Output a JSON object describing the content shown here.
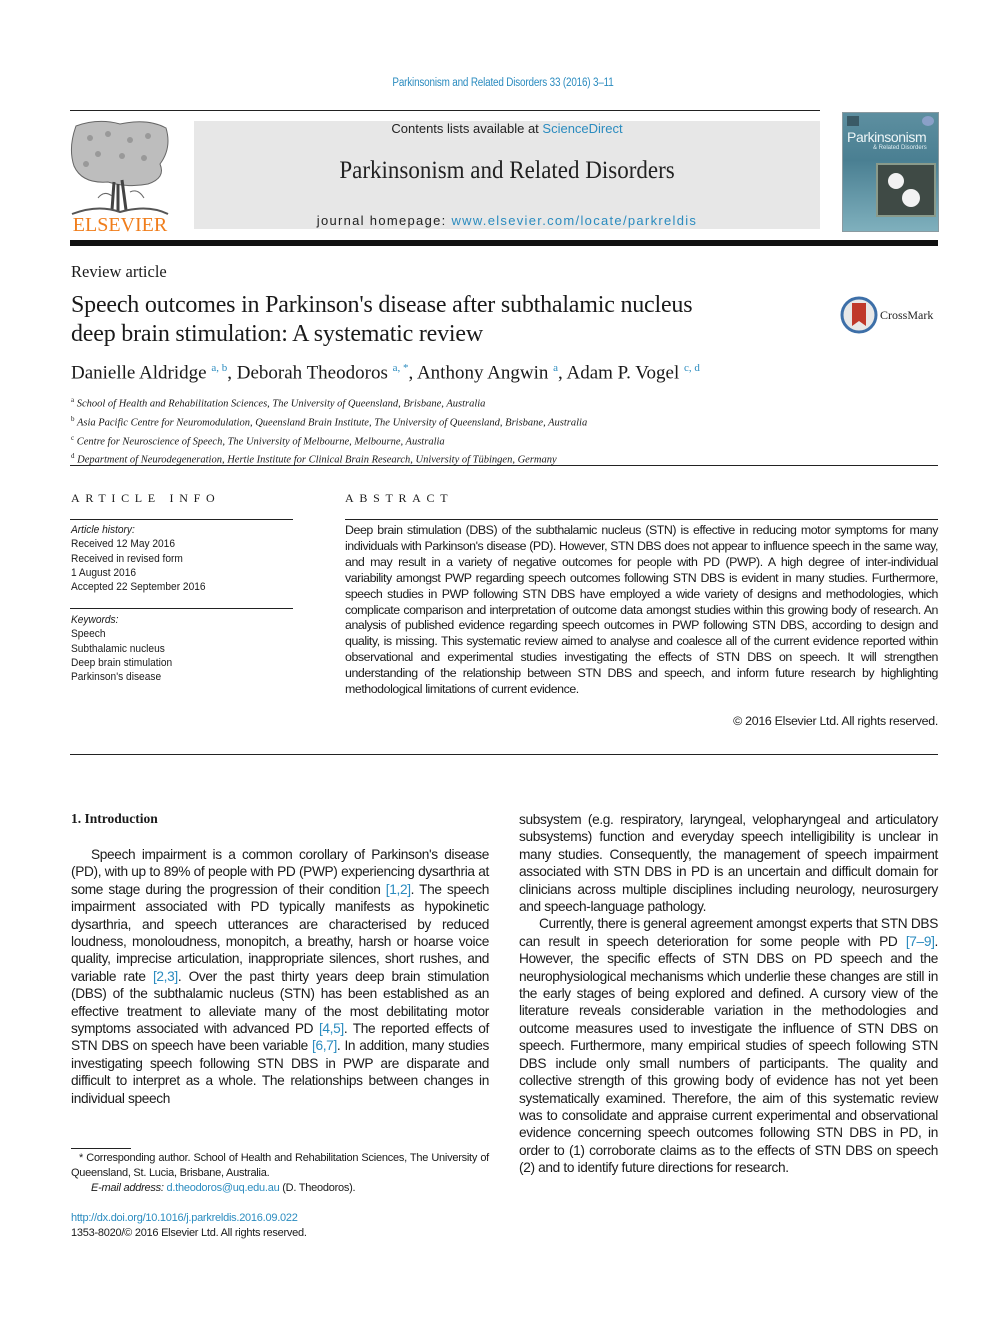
{
  "header": {
    "journal_ref": "Parkinsonism and Related Disorders 33 (2016) 3–11",
    "contents_prefix": "Contents lists available at ",
    "contents_link": "ScienceDirect",
    "journal_title": "Parkinsonism and Related Disorders",
    "homepage_prefix": "journal homepage: ",
    "homepage_link": "www.elsevier.com/locate/parkreldis",
    "publisher_logo": "ELSEVIER",
    "cover_title": "Parkinsonism",
    "cover_subtitle": "& Related Disorders",
    "colors": {
      "link": "#2a8bbf",
      "elsevier_orange": "#f07d1b",
      "banner_bg": "#e7e7e7"
    }
  },
  "article": {
    "type": "Review article",
    "title_line1": "Speech outcomes in Parkinson's disease after subthalamic nucleus",
    "title_line2": "deep brain stimulation: A systematic review",
    "crossmark_label": "CrossMark",
    "authors": [
      {
        "name": "Danielle Aldridge",
        "sup": "a, b",
        "sep": ", "
      },
      {
        "name": "Deborah Theodoros",
        "sup": "a, *",
        "sep": ", "
      },
      {
        "name": "Anthony Angwin",
        "sup": "a",
        "sep": ", "
      },
      {
        "name": "Adam P. Vogel",
        "sup": "c, d",
        "sep": ""
      }
    ],
    "affiliations": [
      {
        "key": "a",
        "text": "School of Health and Rehabilitation Sciences, The University of Queensland, Brisbane, Australia"
      },
      {
        "key": "b",
        "text": "Asia Pacific Centre for Neuromodulation, Queensland Brain Institute, The University of Queensland, Brisbane, Australia"
      },
      {
        "key": "c",
        "text": "Centre for Neuroscience of Speech, The University of Melbourne, Melbourne, Australia"
      },
      {
        "key": "d",
        "text": "Department of Neurodegeneration, Hertie Institute for Clinical Brain Research, University of Tübingen, Germany"
      }
    ]
  },
  "article_info": {
    "heading": "ARTICLE INFO",
    "history_label": "Article history:",
    "history": [
      "Received 12 May 2016",
      "Received in revised form",
      "1 August 2016",
      "Accepted 22 September 2016"
    ],
    "keywords_label": "Keywords:",
    "keywords": [
      "Speech",
      "Subthalamic nucleus",
      "Deep brain stimulation",
      "Parkinson's disease"
    ]
  },
  "abstract": {
    "heading": "ABSTRACT",
    "text": "Deep brain stimulation (DBS) of the subthalamic nucleus (STN) is effective in reducing motor symptoms for many individuals with Parkinson's disease (PD). However, STN DBS does not appear to influence speech in the same way, and may result in a variety of negative outcomes for people with PD (PWP). A high degree of inter-individual variability amongst PWP regarding speech outcomes following STN DBS is evident in many studies. Furthermore, speech studies in PWP following STN DBS have employed a wide variety of designs and methodologies, which complicate comparison and interpretation of outcome data amongst studies within this growing body of research. An analysis of published evidence regarding speech outcomes in PWP following STN DBS, according to design and quality, is missing. This systematic review aimed to analyse and coalesce all of the current evidence reported within observational and experimental studies investigating the effects of STN DBS on speech. It will strengthen understanding of the relationship between STN DBS and speech, and inform future research by highlighting methodological limitations of current evidence.",
    "copyright": "© 2016 Elsevier Ltd. All rights reserved."
  },
  "body": {
    "section_heading": "1.  Introduction",
    "left": [
      {
        "t": "Speech impairment is a common corollary of Parkinson's disease (PD), with up to 89% of people with PD (PWP) experiencing dysarthria at some stage during the progression of their condition "
      },
      {
        "ref": "[1,2]"
      },
      {
        "t": ". The speech impairment associated with PD typically manifests as hypokinetic dysarthria, and speech utterances are characterised by reduced loudness, monoloudness, monopitch, a breathy, harsh or hoarse voice quality, imprecise articulation, inappropriate silences, short rushes, and variable rate "
      },
      {
        "ref": "[2,3]"
      },
      {
        "t": ". Over the past thirty years deep brain stimulation (DBS) of the subthalamic nucleus (STN) has been established as an effective treatment to alleviate many of the most debilitating motor symptoms associated with advanced PD "
      },
      {
        "ref": "[4,5]"
      },
      {
        "t": ". The reported effects of STN DBS on speech have been variable "
      },
      {
        "ref": "[6,7]"
      },
      {
        "t": ". In addition, many studies investigating speech following STN DBS in PWP are disparate and difficult to interpret as a whole. The relationships between changes in individual speech"
      }
    ],
    "right_p1": "subsystem (e.g. respiratory, laryngeal, velopharyngeal and articulatory subsystems) function and everyday speech intelligibility is unclear in many studies. Consequently, the management of speech impairment associated with STN DBS in PD is an uncertain and difficult domain for clinicians across multiple disciplines including neurology, neurosurgery and speech-language pathology.",
    "right_p2": [
      {
        "t": "Currently, there is general agreement amongst experts that STN DBS can result in speech deterioration for some people with PD "
      },
      {
        "ref": "[7–9]"
      },
      {
        "t": ". However, the specific effects of STN DBS on PD speech and the neurophysiological mechanisms which underlie these changes are still in the early stages of being explored and defined. A cursory view of the literature reveals considerable variation in the methodologies and outcome measures used to investigate the influence of STN DBS on speech. Furthermore, many empirical studies of speech following STN DBS include only small numbers of participants. The quality and collective strength of this growing body of evidence has not yet been systematically examined. Therefore, the aim of this systematic review was to consolidate and appraise current experimental and observational evidence concerning speech outcomes following STN DBS in PD, in order to (1) corroborate claims as to the effects of STN DBS on speech (2) and to identify future directions for research."
      }
    ]
  },
  "footnote": {
    "corresponding": "* Corresponding author. School of Health and Rehabilitation Sciences, The University of Queensland, St. Lucia, Brisbane, Australia.",
    "email_label": "E-mail address: ",
    "email": "d.theodoros@uq.edu.au",
    "email_suffix": " (D. Theodoros).",
    "doi": "http://dx.doi.org/10.1016/j.parkreldis.2016.09.022",
    "issn_copyright": "1353-8020/© 2016 Elsevier Ltd. All rights reserved."
  }
}
